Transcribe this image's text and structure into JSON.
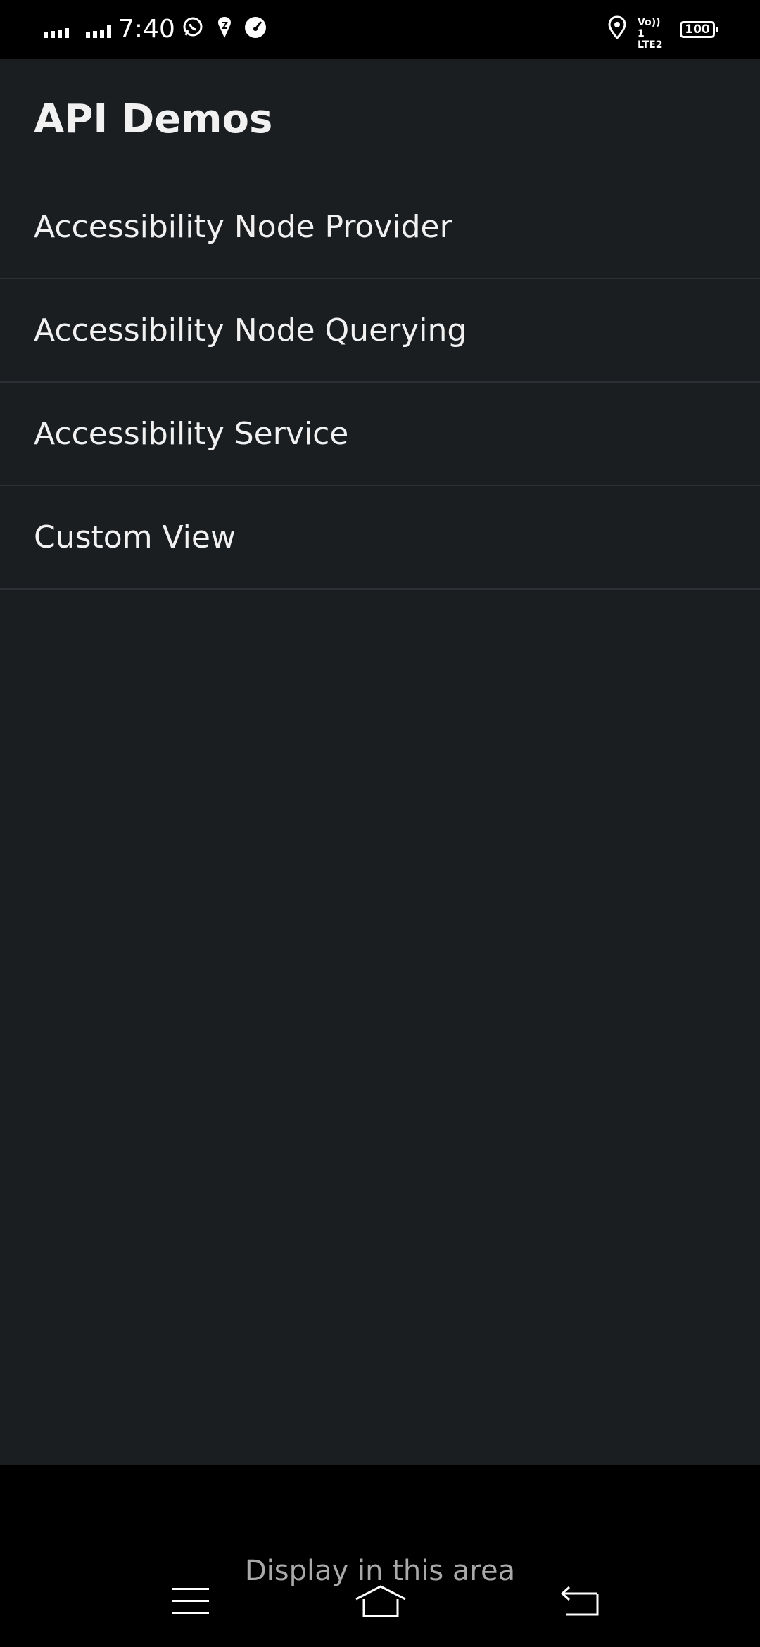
{
  "status_bar": {
    "time": "7:40",
    "battery_level": "100",
    "network_label": "Vo)) 1 LTE2",
    "icons": [
      "signal-icon",
      "signal-icon",
      "whatsapp-icon",
      "notification-icon",
      "speed-icon",
      "location-icon",
      "lte-icon",
      "battery-icon"
    ]
  },
  "app": {
    "title": "API Demos"
  },
  "list": {
    "items": [
      {
        "label": "Accessibility Node Provider"
      },
      {
        "label": "Accessibility Node Querying"
      },
      {
        "label": "Accessibility Service"
      },
      {
        "label": "Custom View"
      }
    ]
  },
  "bottom": {
    "display_text": "Display in this area"
  },
  "nav_bar": {
    "icons": [
      "menu-icon",
      "home-icon",
      "back-icon"
    ]
  },
  "colors": {
    "background": "#1b1e21",
    "status_bar": "#000000",
    "text_primary": "#f1f1f1",
    "text_secondary": "#a9a9a9",
    "divider": "#2c3034"
  }
}
